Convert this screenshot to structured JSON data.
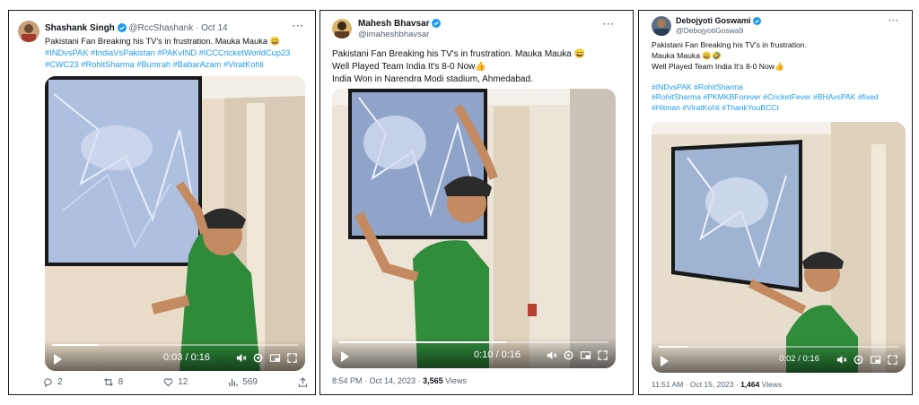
{
  "tweets": [
    {
      "name": "Shashank Singh",
      "handle": "@RccShashank",
      "date": "· Oct 14",
      "text_plain": "Pakistani Fan Breaking his TV's in frustration. Mauka Mauka 😄",
      "hashtags_line1": "#INDvsPAK #IndiaVsPakistan #PAKvIND #ICCCricketWorldCup23",
      "hashtags_line2": "#CWC23 #RohitSharma #Bumrah #BabarAzam #ViratKohli",
      "video_time": "0:03 / 0:16",
      "video_progress": 0.19,
      "replies": "2",
      "retweets": "8",
      "likes": "12",
      "views": "569"
    },
    {
      "name": "Mahesh Bhavsar",
      "handle": "@imaheshbhavsar",
      "line1": "Pakistani Fan Breaking his TV's in frustration. Mauka Mauka 😄",
      "line2": "Well Played Team India It's 8-0 Now👍",
      "line3": "India Won in Narendra Modi stadium, Ahmedabad.",
      "video_time": "0:10 / 0:16",
      "video_progress": 0.62,
      "timestamp": "8:54 PM · Oct 14, 2023 · ",
      "views_count": "3,565",
      "views_label": " Views"
    },
    {
      "name": "Debojyoti Goswami",
      "handle": "@DebojyotiGoswa9",
      "line1": "Pakistani Fan Breaking his TV's in frustration.",
      "line2": "Mauka Mauka 😄🤣",
      "line3": "Well Played Team India It's 8-0 Now👍",
      "hash1": "#INDvsPAK #RohitSharma",
      "hash2": "#RohitSharma #PKMKBForever #CricketFever #BHAvsPAK #fixed",
      "hash3": "#Hitman #ViratKohli #ThankYouBCCI",
      "video_time": "0:02 / 0:16",
      "video_progress": 0.12,
      "timestamp": "11:51 AM · Oct 15, 2023 · ",
      "views_count": "1,464",
      "views_label": " Views"
    }
  ],
  "more_label": "···",
  "colors": {
    "link": "#1d9bf0",
    "verified": "#1d9bf0",
    "muted": "#536471"
  }
}
